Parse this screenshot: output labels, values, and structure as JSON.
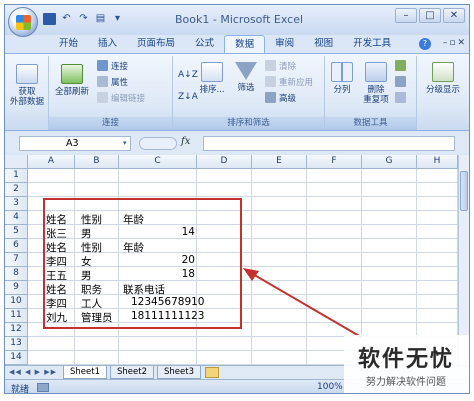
{
  "window": {
    "title": "Book1 - Microsoft Excel",
    "controls": [
      "–",
      "□",
      "✕"
    ]
  },
  "ribbon_tabs": [
    {
      "label": "开始"
    },
    {
      "label": "插入"
    },
    {
      "label": "页面布局"
    },
    {
      "label": "公式"
    },
    {
      "label": "数据",
      "active": true
    },
    {
      "label": "审阅"
    },
    {
      "label": "视图"
    },
    {
      "label": "开发工具"
    }
  ],
  "ribbon": {
    "get_external": "获取\n外部数据",
    "connections": {
      "refresh_all": "全部刷新",
      "connections": "连接",
      "properties": "属性",
      "edit_links": "编辑链接",
      "label": "连接"
    },
    "sort_filter": {
      "sort_asc": "A↓Z",
      "sort": "排序...",
      "filter": "筛选",
      "clear": "清除",
      "reapply": "重新应用",
      "advanced": "高级",
      "label": "排序和筛选"
    },
    "data_tools": {
      "text_to_columns": "分列",
      "remove_duplicates": "删除\n重复项",
      "label": "数据工具"
    },
    "outline": {
      "label": "分级显示"
    }
  },
  "formula_bar": {
    "name_box": "A3",
    "fx": "fx",
    "value": ""
  },
  "columns": [
    "A",
    "B",
    "C",
    "D",
    "E",
    "F",
    "G",
    "H"
  ],
  "rows": [
    "1",
    "2",
    "3",
    "4",
    "5",
    "6",
    "7",
    "8",
    "9",
    "10",
    "11",
    "12",
    "13",
    "14"
  ],
  "cells": {
    "r4": {
      "a": "姓名",
      "b": "性别",
      "c": "年龄"
    },
    "r5": {
      "a": "张三",
      "b": "男",
      "c": "14"
    },
    "r6": {
      "a": "姓名",
      "b": "性别",
      "c": "年龄"
    },
    "r7": {
      "a": "李四",
      "b": "女",
      "c": "20"
    },
    "r8": {
      "a": "王五",
      "b": "男",
      "c": "18"
    },
    "r9": {
      "a": "姓名",
      "b": "职务",
      "c": "联系电话"
    },
    "r10": {
      "a": "李四",
      "b": "工人",
      "c": "12345678910"
    },
    "r11": {
      "a": "刘九",
      "b": "管理员",
      "c": "18111111123"
    }
  },
  "sheet_tabs": [
    "Sheet1",
    "Sheet2",
    "Sheet3"
  ],
  "status": {
    "ready": "就绪",
    "zoom": "100%"
  },
  "watermark": {
    "logo": "软件无忧",
    "sub": "努力解决软件问题"
  },
  "colors": {
    "accent": "#15428b",
    "annotation": "#c4322f"
  }
}
